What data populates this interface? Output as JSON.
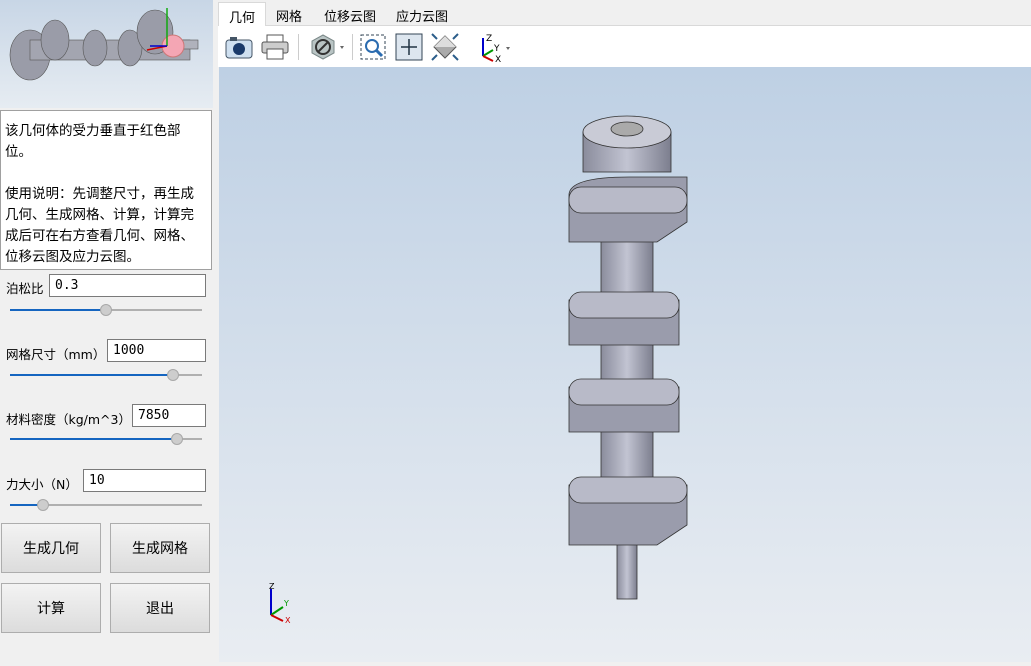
{
  "description": "该几何体的受力垂直于红色部位。\n\n使用说明：先调整尺寸，再生成几何、生成网格、计算，计算完成后可在右方查看几何、网格、位移云图及应力云图。",
  "params": [
    {
      "label": "泊松比",
      "value": "0.3",
      "slider": 0.5
    },
    {
      "label": "网格尺寸（mm）",
      "value": "1000",
      "slider": 0.85
    },
    {
      "label": "材料密度（kg/m^3）",
      "value": "7850",
      "slider": 0.87
    },
    {
      "label": "力大小（N）",
      "value": "10",
      "slider": 0.17
    }
  ],
  "buttons": {
    "gen_geometry": "生成几何",
    "gen_mesh": "生成网格",
    "compute": "计算",
    "exit": "退出"
  },
  "tabs": [
    {
      "label": "几何",
      "active": true
    },
    {
      "label": "网格"
    },
    {
      "label": "位移云图"
    },
    {
      "label": "应力云图"
    }
  ],
  "toolbar": [
    "camera-icon",
    "print-icon",
    "display-mode-icon",
    "zoom-window-icon",
    "fit-all-icon",
    "view-iso-icon",
    "axes-icon"
  ],
  "triad": {
    "x": "X",
    "y": "Y",
    "z": "Z"
  },
  "colors": {
    "accent": "#1565c0",
    "highlight": "#f4a6b4",
    "model": "#8c8fa0"
  }
}
